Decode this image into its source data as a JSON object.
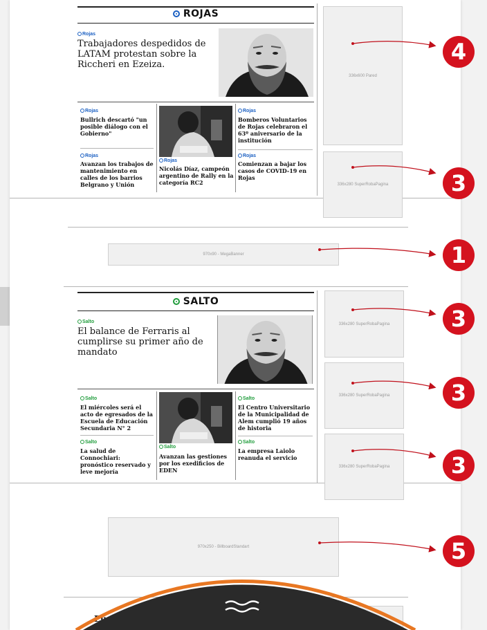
{
  "sections": [
    {
      "title": "ROJAS",
      "accent": "#1a5fc2",
      "main": {
        "tag": "Rojas",
        "headline": "Trabajadores despedidos de LATAM protestan sobre la Riccheri en Ezeiza."
      },
      "items": [
        {
          "tag": "Rojas",
          "headline": "Bullrich descartó \"un posible diálogo con el Gobierno\""
        },
        {
          "tag": "Rojas",
          "headline": "Avanzan los trabajos de mantenimiento en calles de los barrios Belgrano y Unión"
        },
        {
          "tag": "Rojas",
          "headline": "Nicolás Díaz, campeón argentino de Rally en la categoría RC2"
        },
        {
          "tag": "Rojas",
          "headline": "Bomberos Voluntarios de Rojas celebraron el 63º aniversario de la institución"
        },
        {
          "tag": "Rojas",
          "headline": "Comienzan a bajar los casos de COVID-19 en Rojas"
        }
      ]
    },
    {
      "title": "SALTO",
      "accent": "#1f9c3b",
      "main": {
        "tag": "Salto",
        "headline": "El balance de Ferraris al cumplirse su primer año de mandato"
      },
      "items": [
        {
          "tag": "Salto",
          "headline": "El miércoles será el acto de egresados de la Escuela de Educación Secundaria N° 2"
        },
        {
          "tag": "Salto",
          "headline": "La salud de Connochiari: pronóstico reservado y leve mejoría"
        },
        {
          "tag": "Salto",
          "headline": "Avanzan las gestiones por los exedificios de EDEN"
        },
        {
          "tag": "Salto",
          "headline": "El Centro Universitario de la Municipalidad de Alem cumplió 19 años de historia"
        },
        {
          "tag": "Salto",
          "headline": "La empresa Laiolo reanuda el servicio"
        }
      ]
    }
  ],
  "ads": {
    "pared": "336x600 Pared",
    "super1": "336x280 SuperRobaPagina",
    "mega": "970x90 - MegaBanner",
    "super2": "336x280 SuperRobaPagina",
    "super3": "336x280 SuperRobaPagina",
    "super4": "336x280 SuperRobaPagina",
    "billboard": "970x250 - BillboardStandart"
  },
  "badges": {
    "b4": "4",
    "b3a": "3",
    "b1": "1",
    "b3b": "3",
    "b3c": "3",
    "b3d": "3",
    "b5": "5"
  },
  "footer_partial": "Eu",
  "colors": {
    "badge": "#d4121e",
    "arrow": "#c0101b",
    "orange_ring": "#e87722"
  }
}
